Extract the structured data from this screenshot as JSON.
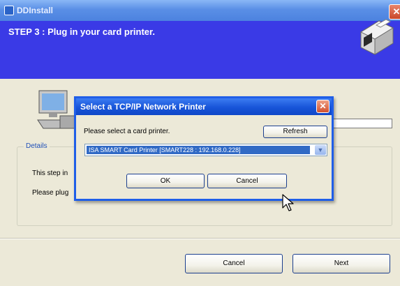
{
  "main_window": {
    "title": "DDInstall",
    "close_glyph": "✕",
    "step_title": "STEP 3 : Plug in your card printer.",
    "details_label": "Details",
    "details_line1": "This step in",
    "details_line2": "Please plug",
    "cancel_label": "Cancel",
    "next_label": "Next"
  },
  "dialog": {
    "title": "Select a TCP/IP Network Printer",
    "close_glyph": "✕",
    "prompt": "Please select a card printer.",
    "refresh_label": "Refresh",
    "selected_printer": "ISA SMART Card Printer  [SMART228 : 192.168.0.228]",
    "dropdown_glyph": "▼",
    "ok_label": "OK",
    "cancel_label": "Cancel"
  },
  "colors": {
    "header_blue": "#3a3ae6",
    "dialog_border": "#1f5ee8",
    "selection": "#316ac5"
  },
  "icons": [
    "app-icon",
    "close-icon",
    "printer-illustration",
    "computer-illustration",
    "dropdown-arrow-icon",
    "mouse-cursor-icon"
  ]
}
